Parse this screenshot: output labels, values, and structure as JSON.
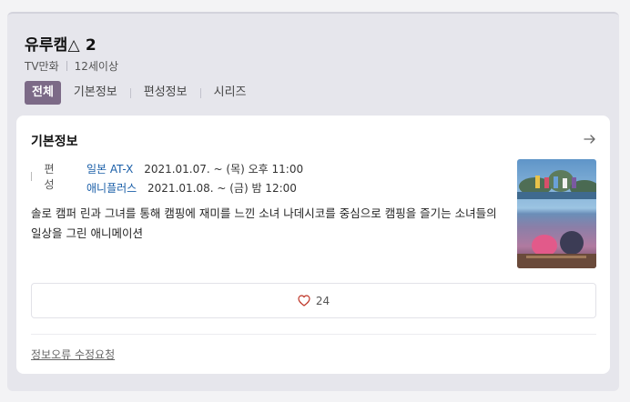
{
  "title": "유루캠△ 2",
  "meta": {
    "type": "TV만화",
    "rating": "12세이상"
  },
  "tabs": [
    {
      "label": "전체",
      "active": true
    },
    {
      "label": "기본정보",
      "active": false
    },
    {
      "label": "편성정보",
      "active": false
    },
    {
      "label": "시리즈",
      "active": false
    }
  ],
  "card": {
    "title": "기본정보",
    "arrow_icon": "arrow-right-icon",
    "schedule_label": "편성",
    "schedule": [
      {
        "channel": "일본 AT-X",
        "time": "2021.01.07. ~  (목) 오후 11:00"
      },
      {
        "channel": "애니플러스",
        "time": "2021.01.08. ~  (금) 밤 12:00"
      }
    ],
    "description": "솔로 캠퍼 린과 그녀를 통해 캠핑에 재미를 느낀 소녀 나데시코를 중심으로 캠핑을 즐기는 소녀들의 일상을 그린 애니메이션",
    "like_icon": "heart-icon",
    "like_count": "24",
    "report_label": "정보오류 수정요청"
  },
  "colors": {
    "accent": "#7c6a87",
    "channel_link": "#1b5fa8",
    "heart": "#c0392b"
  }
}
